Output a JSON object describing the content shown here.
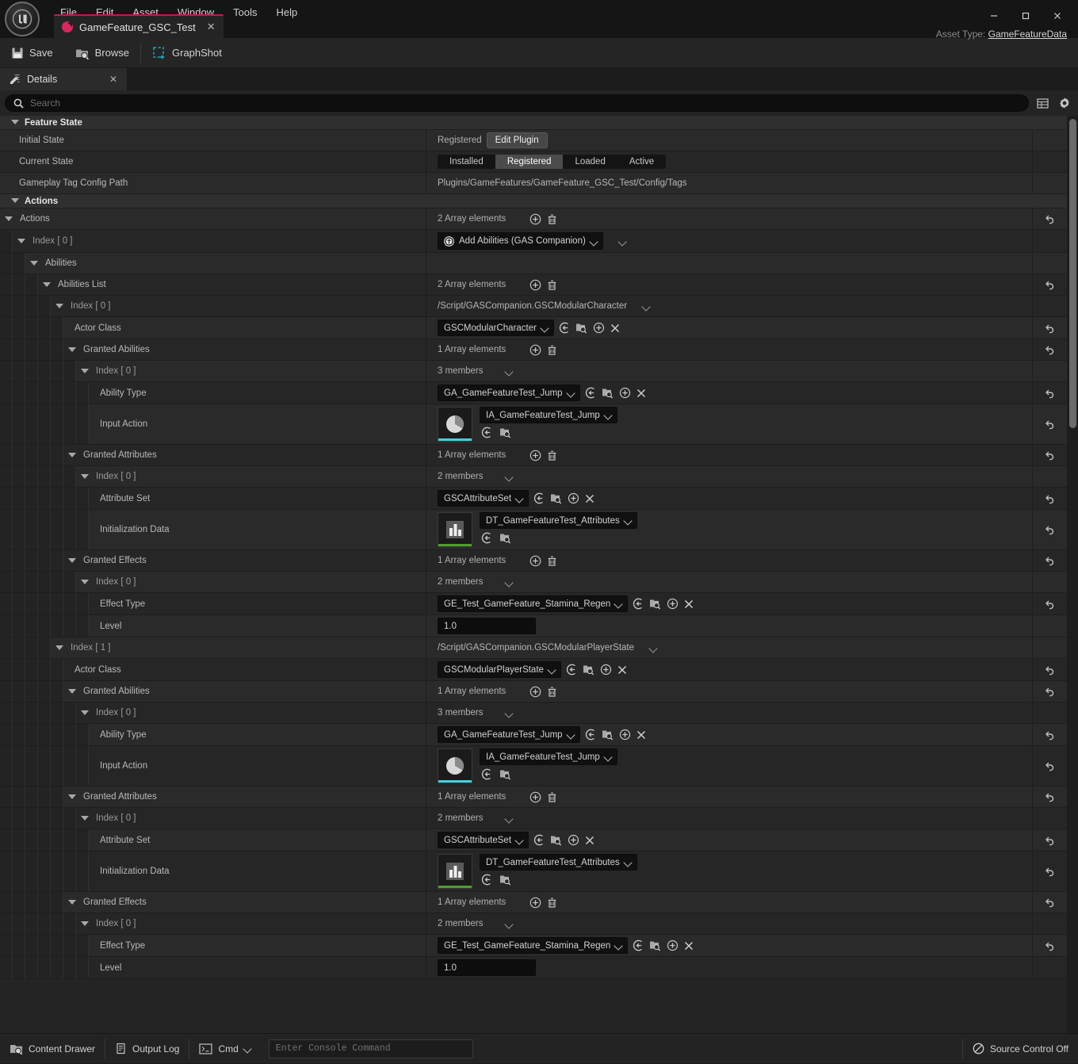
{
  "window": {
    "app_logo": "unreal-logo",
    "menu": [
      "File",
      "Edit",
      "Asset",
      "Window",
      "Tools",
      "Help"
    ],
    "minimize": "—",
    "maximize": "▢",
    "close": "✕",
    "asset_type_label": "Asset Type:",
    "asset_type_value": "GameFeatureData",
    "tab": {
      "title": "GameFeature_GSC_Test",
      "close": "✕",
      "accent": "#c4184f"
    }
  },
  "toolbar": {
    "save": "Save",
    "browse": "Browse",
    "graphshot": "GraphShot"
  },
  "details_panel": {
    "tab_label": "Details",
    "tab_close": "✕",
    "search_placeholder": "Search",
    "search_value": ""
  },
  "categories": {
    "feature_state": "Feature State",
    "actions": "Actions"
  },
  "feature_state": {
    "initial_state": {
      "label": "Initial State",
      "value": "Registered",
      "button": "Edit Plugin"
    },
    "current_state": {
      "label": "Current State",
      "options": [
        "Installed",
        "Registered",
        "Loaded",
        "Active"
      ],
      "selected": "Registered"
    },
    "tag_config_path": {
      "label": "Gameplay Tag Config Path",
      "value": "Plugins/GameFeatures/GameFeature_GSC_Test/Config/Tags"
    }
  },
  "actions": {
    "label": "Actions",
    "count_text": "2 Array elements",
    "index0": {
      "label": "Index [ 0 ]",
      "action_type": "Add Abilities (GAS Companion)"
    },
    "abilities": {
      "label": "Abilities",
      "list_label": "Abilities List",
      "list_count": "2 Array elements"
    }
  },
  "entries": [
    {
      "index_label": "Index [ 0 ]",
      "index_value": "/Script/GASCompanion.GSCModularCharacter",
      "actor_class_label": "Actor Class",
      "actor_class_value": "GSCModularCharacter",
      "granted_abilities_label": "Granted Abilities",
      "granted_abilities_count": "1 Array elements",
      "ability_index_label": "Index [ 0 ]",
      "ability_members": "3 members",
      "ability_type_label": "Ability Type",
      "ability_type_value": "GA_GameFeatureTest_Jump",
      "input_action_label": "Input Action",
      "input_action_value": "IA_GameFeatureTest_Jump",
      "input_action_thumb": "pie-chart-thumbnail",
      "input_action_accent": "#3fd2e0",
      "granted_attributes_label": "Granted Attributes",
      "granted_attributes_count": "1 Array elements",
      "attr_index_label": "Index [ 0 ]",
      "attr_members": "2 members",
      "attribute_set_label": "Attribute Set",
      "attribute_set_value": "GSCAttributeSet",
      "init_data_label": "Initialization Data",
      "init_data_value": "DT_GameFeatureTest_Attributes",
      "init_data_thumb": "bar-chart-thumbnail",
      "init_data_accent": "#4f9c2e",
      "granted_effects_label": "Granted Effects",
      "granted_effects_count": "1 Array elements",
      "effect_index_label": "Index [ 0 ]",
      "effect_members": "2 members",
      "effect_type_label": "Effect Type",
      "effect_type_value": "GE_Test_GameFeature_Stamina_Regen",
      "level_label": "Level",
      "level_value": "1.0"
    },
    {
      "index_label": "Index [ 1 ]",
      "index_value": "/Script/GASCompanion.GSCModularPlayerState",
      "actor_class_label": "Actor Class",
      "actor_class_value": "GSCModularPlayerState",
      "granted_abilities_label": "Granted Abilities",
      "granted_abilities_count": "1 Array elements",
      "ability_index_label": "Index [ 0 ]",
      "ability_members": "3 members",
      "ability_type_label": "Ability Type",
      "ability_type_value": "GA_GameFeatureTest_Jump",
      "input_action_label": "Input Action",
      "input_action_value": "IA_GameFeatureTest_Jump",
      "input_action_thumb": "pie-chart-thumbnail",
      "input_action_accent": "#3fd2e0",
      "granted_attributes_label": "Granted Attributes",
      "granted_attributes_count": "1 Array elements",
      "attr_index_label": "Index [ 0 ]",
      "attr_members": "2 members",
      "attribute_set_label": "Attribute Set",
      "attribute_set_value": "GSCAttributeSet",
      "init_data_label": "Initialization Data",
      "init_data_value": "DT_GameFeatureTest_Attributes",
      "init_data_thumb": "bar-chart-thumbnail",
      "init_data_accent": "#4f9c2e",
      "granted_effects_label": "Granted Effects",
      "granted_effects_count": "1 Array elements",
      "effect_index_label": "Index [ 0 ]",
      "effect_members": "2 members",
      "effect_type_label": "Effect Type",
      "effect_type_value": "GE_Test_GameFeature_Stamina_Regen",
      "level_label": "Level",
      "level_value": "1.0"
    }
  ],
  "statusbar": {
    "content_drawer": "Content Drawer",
    "output_log": "Output Log",
    "cmd": "Cmd",
    "console_placeholder": "Enter Console Command",
    "console_value": "",
    "source_control": "Source Control Off"
  }
}
